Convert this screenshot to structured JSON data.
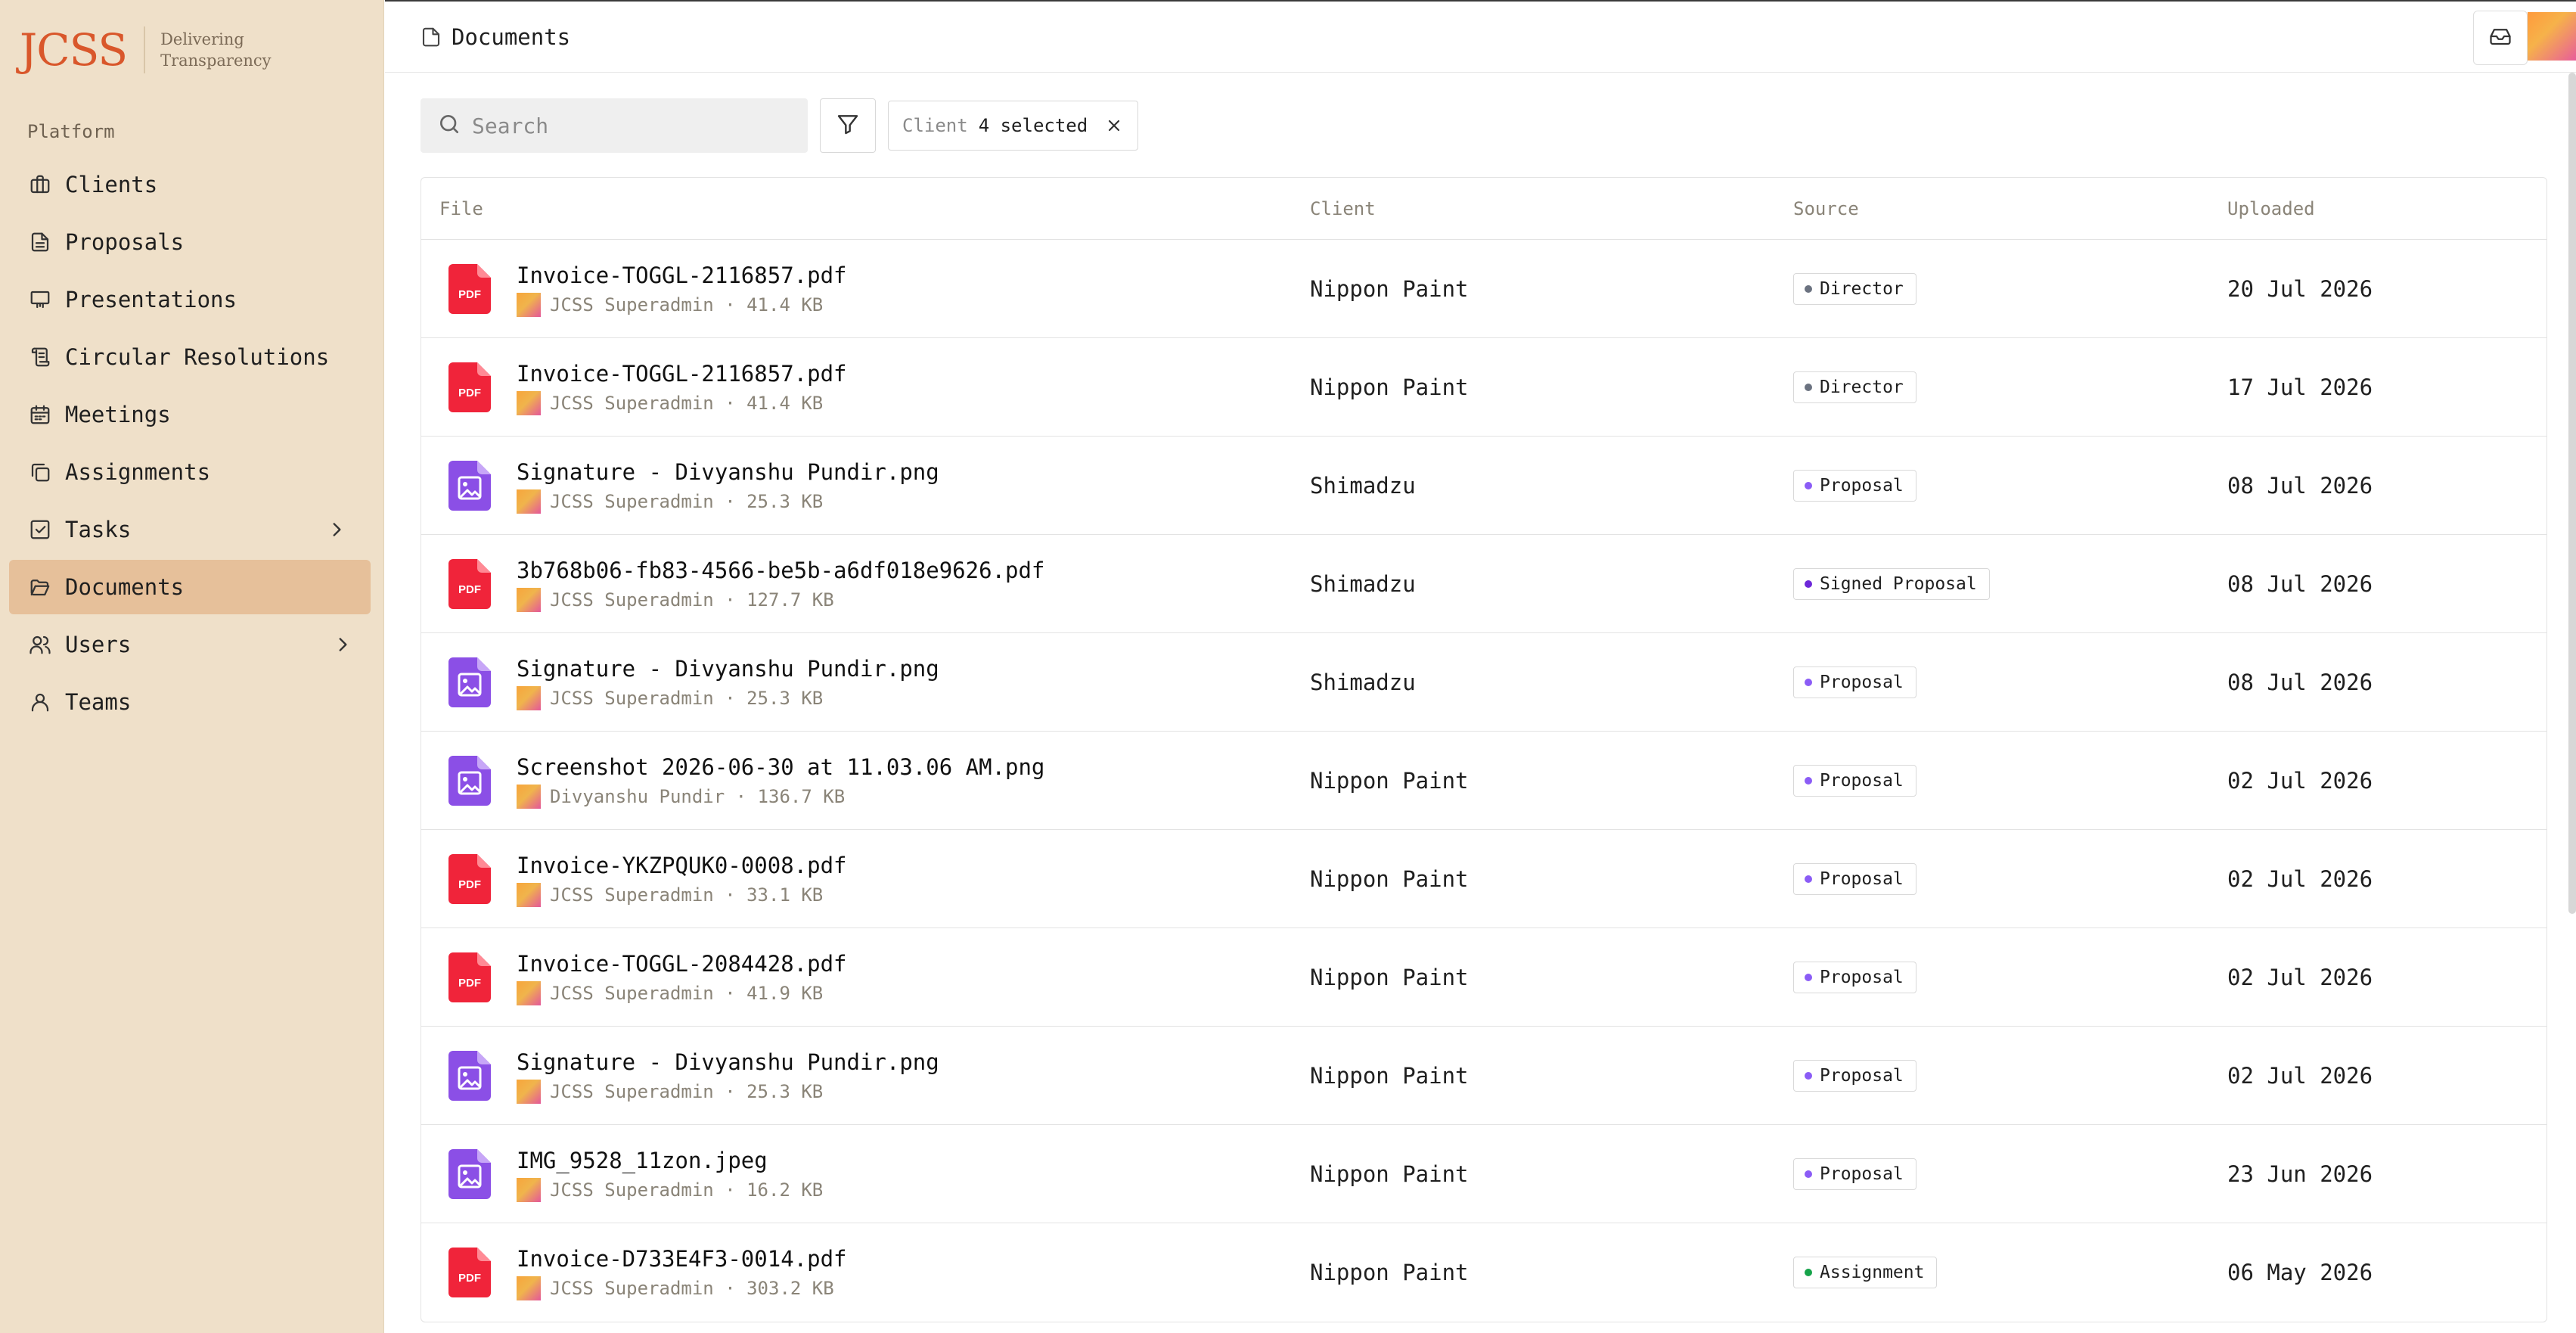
{
  "brand": {
    "logo": "JCSS",
    "tagline_1": "Delivering",
    "tagline_2": "Transparency"
  },
  "sidebar": {
    "section": "Platform",
    "items": [
      {
        "label": "Clients",
        "icon": "briefcase-icon"
      },
      {
        "label": "Proposals",
        "icon": "document-icon"
      },
      {
        "label": "Presentations",
        "icon": "presentation-icon"
      },
      {
        "label": "Circular Resolutions",
        "icon": "scroll-icon"
      },
      {
        "label": "Meetings",
        "icon": "calendar-icon"
      },
      {
        "label": "Assignments",
        "icon": "copy-icon"
      },
      {
        "label": "Tasks",
        "icon": "checkbox-icon"
      },
      {
        "label": "Documents",
        "icon": "folder-open-icon"
      },
      {
        "label": "Users",
        "icon": "users-icon"
      },
      {
        "label": "Teams",
        "icon": "user-icon"
      }
    ]
  },
  "header": {
    "title": "Documents"
  },
  "toolbar": {
    "search_placeholder": "Search",
    "filter_key": "Client",
    "filter_value": "4 selected"
  },
  "table": {
    "columns": [
      "File",
      "Client",
      "Source",
      "Uploaded"
    ],
    "rows": [
      {
        "type": "pdf",
        "name": "Invoice-TOGGL-2116857.pdf",
        "uploader": "JCSS Superadmin",
        "size": "41.4 KB",
        "client": "Nippon Paint",
        "source": "Director",
        "uploaded": "20 Jul 2026"
      },
      {
        "type": "pdf",
        "name": "Invoice-TOGGL-2116857.pdf",
        "uploader": "JCSS Superadmin",
        "size": "41.4 KB",
        "client": "Nippon Paint",
        "source": "Director",
        "uploaded": "17 Jul 2026"
      },
      {
        "type": "img",
        "name": "Signature - Divyanshu Pundir.png",
        "uploader": "JCSS Superadmin",
        "size": "25.3 KB",
        "client": "Shimadzu",
        "source": "Proposal",
        "uploaded": "08 Jul 2026"
      },
      {
        "type": "pdf",
        "name": "3b768b06-fb83-4566-be5b-a6df018e9626.pdf",
        "uploader": "JCSS Superadmin",
        "size": "127.7 KB",
        "client": "Shimadzu",
        "source": "Signed Proposal",
        "uploaded": "08 Jul 2026"
      },
      {
        "type": "img",
        "name": "Signature - Divyanshu Pundir.png",
        "uploader": "JCSS Superadmin",
        "size": "25.3 KB",
        "client": "Shimadzu",
        "source": "Proposal",
        "uploaded": "08 Jul 2026"
      },
      {
        "type": "img",
        "name": "Screenshot 2026-06-30 at 11.03.06 AM.png",
        "uploader": "Divyanshu Pundir",
        "size": "136.7 KB",
        "client": "Nippon Paint",
        "source": "Proposal",
        "uploaded": "02 Jul 2026"
      },
      {
        "type": "pdf",
        "name": "Invoice-YKZPQUK0-0008.pdf",
        "uploader": "JCSS Superadmin",
        "size": "33.1 KB",
        "client": "Nippon Paint",
        "source": "Proposal",
        "uploaded": "02 Jul 2026"
      },
      {
        "type": "pdf",
        "name": "Invoice-TOGGL-2084428.pdf",
        "uploader": "JCSS Superadmin",
        "size": "41.9 KB",
        "client": "Nippon Paint",
        "source": "Proposal",
        "uploaded": "02 Jul 2026"
      },
      {
        "type": "img",
        "name": "Signature - Divyanshu Pundir.png",
        "uploader": "JCSS Superadmin",
        "size": "25.3 KB",
        "client": "Nippon Paint",
        "source": "Proposal",
        "uploaded": "02 Jul 2026"
      },
      {
        "type": "img",
        "name": "IMG_9528_11zon.jpeg",
        "uploader": "JCSS Superadmin",
        "size": "16.2 KB",
        "client": "Nippon Paint",
        "source": "Proposal",
        "uploaded": "23 Jun 2026"
      },
      {
        "type": "pdf",
        "name": "Invoice-D733E4F3-0014.pdf",
        "uploader": "JCSS Superadmin",
        "size": "303.2 KB",
        "client": "Nippon Paint",
        "source": "Assignment",
        "uploaded": "06 May 2026"
      }
    ]
  },
  "colors": {
    "brand": "#d9572b",
    "sidebar_bg": "#efe0c9",
    "active_item": "#e6c09a",
    "pdf_icon": "#f0243a",
    "image_icon": "#8b4fe6",
    "source_director": "#6b7280",
    "source_proposal": "#8b5cf6",
    "source_signed_proposal": "#6d28d9",
    "source_assignment": "#16a34a"
  }
}
